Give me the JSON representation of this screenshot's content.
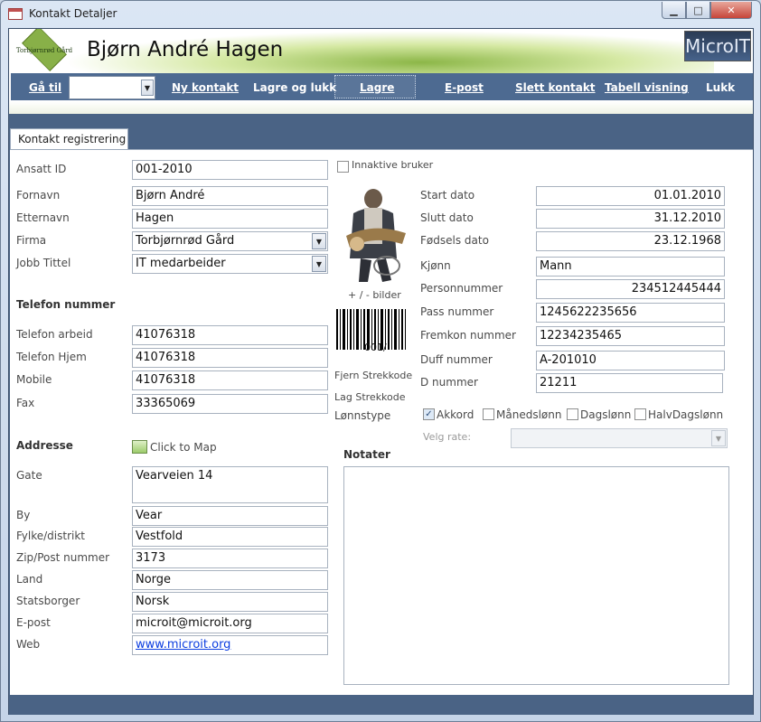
{
  "window": {
    "title": "Kontakt Detaljer",
    "controls": {
      "minimize": "▁",
      "maximize": "□",
      "close": "✕"
    }
  },
  "header": {
    "contact_name": "Bjørn André Hagen",
    "logo_text": "Torbjørnrød Gård",
    "brand_logo": "MicroIT"
  },
  "nav": {
    "goto_label": "Gå til",
    "goto_value": "",
    "items": [
      "Ny kontakt",
      "Lagre og lukk",
      "Lagre",
      "E-post",
      "Slett kontakt",
      "Tabell visning",
      "Lukk"
    ]
  },
  "tab": {
    "label": "Kontakt registrering"
  },
  "left": {
    "ansatt_id": {
      "label": "Ansatt ID",
      "value": "001-2010"
    },
    "fornavn": {
      "label": "Fornavn",
      "value": "Bjørn André"
    },
    "etternavn": {
      "label": "Etternavn",
      "value": "Hagen"
    },
    "firma": {
      "label": "Firma",
      "value": "Torbjørnrød Gård"
    },
    "jobb_tittel": {
      "label": "Jobb Tittel",
      "value": "IT medarbeider"
    },
    "telefon_header": "Telefon nummer",
    "telefon_arbeid": {
      "label": "Telefon arbeid",
      "value": "41076318"
    },
    "telefon_hjem": {
      "label": "Telefon Hjem",
      "value": "41076318"
    },
    "mobile": {
      "label": "Mobile",
      "value": "41076318"
    },
    "fax": {
      "label": "Fax",
      "value": "33365069"
    },
    "adresse_header": "Addresse",
    "click_to_map": "Click to Map",
    "gate": {
      "label": "Gate",
      "value": "Vearveien 14"
    },
    "by": {
      "label": "By",
      "value": "Vear"
    },
    "fylke": {
      "label": "Fylke/distrikt",
      "value": "Vestfold"
    },
    "zip": {
      "label": "Zip/Post nummer",
      "value": "3173"
    },
    "land": {
      "label": "Land",
      "value": "Norge"
    },
    "statsborger": {
      "label": "Statsborger",
      "value": "Norsk"
    },
    "epost": {
      "label": "E-post",
      "value": "microit@microit.org"
    },
    "web": {
      "label": "Web",
      "value": "www.microit.org"
    }
  },
  "middle": {
    "inaktive": {
      "label": "Innaktive bruker",
      "checked": false
    },
    "bilder_link": "+ / -  bilder",
    "barcode_text": "001/",
    "fjern_strekkode": "Fjern Strekkode",
    "lag_strekkode": "Lag Strekkode",
    "lonnstype_label": "Lønnstype"
  },
  "right": {
    "start_dato": {
      "label": "Start dato",
      "value": "01.01.2010"
    },
    "slutt_dato": {
      "label": "Slutt dato",
      "value": "31.12.2010"
    },
    "fodsels_dato": {
      "label": "Fødsels dato",
      "value": "23.12.1968"
    },
    "kjonn": {
      "label": "Kjønn",
      "value": "Mann"
    },
    "personnummer": {
      "label": "Personnummer",
      "value": "234512445444"
    },
    "pass_nummer": {
      "label": "Pass nummer",
      "value": "1245622235656"
    },
    "fremkon_nummer": {
      "label": "Fremkon nummer",
      "value": "12234235465"
    },
    "duff_nummer": {
      "label": "Duff nummer",
      "value": "A-201010"
    },
    "d_nummer": {
      "label": "D nummer",
      "value": "21211"
    },
    "pay_types": [
      {
        "label": "Akkord",
        "checked": true
      },
      {
        "label": "Månedslønn",
        "checked": false
      },
      {
        "label": "Dagslønn",
        "checked": false
      },
      {
        "label": "HalvDagslønn",
        "checked": false
      }
    ],
    "velg_rate_label": "Velg rate:",
    "velg_rate_value": "",
    "notater_label": "Notater",
    "notater_value": ""
  },
  "colors": {
    "accent": "#4d6a91",
    "link": "#0b3de0",
    "brand_green": "#88b048"
  },
  "icons": {
    "app": "form-icon",
    "dropdown": "chevron-down-icon",
    "map": "map-icon",
    "check": "check-icon"
  }
}
